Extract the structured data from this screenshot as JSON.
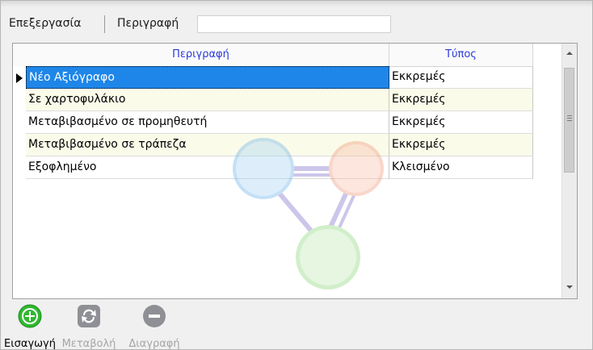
{
  "filter": {
    "mode_label": "Επεξεργασία",
    "field_label": "Περιγραφή",
    "value": ""
  },
  "grid": {
    "columns": [
      "Περιγραφή",
      "Τύπος"
    ],
    "rows": [
      {
        "description": "Νέο Αξιόγραφο",
        "type": "Εκκρεμές",
        "selected": true
      },
      {
        "description": "Σε χαρτοφυλάκιο",
        "type": "Εκκρεμές"
      },
      {
        "description": "Μεταβιβασμένο σε προμηθευτή",
        "type": "Εκκρεμές"
      },
      {
        "description": "Μεταβιβασμένο σε τράπεζα",
        "type": "Εκκρεμές"
      },
      {
        "description": "Εξοφλημένο",
        "type": "Κλεισμένο"
      }
    ]
  },
  "toolbar": {
    "insert_label": "Εισαγωγή",
    "modify_label": "Μεταβολή",
    "delete_label": "Διαγραφή"
  },
  "colors": {
    "selection": "#1e86e8",
    "header_text": "#2b3bd8",
    "alt_row": "#fbfbea",
    "insert_icon": "#2fb82f",
    "disabled_icon": "#8e9095"
  },
  "icons": {
    "insert": "plus-circle-icon",
    "modify": "refresh-arrows-icon",
    "delete": "minus-circle-icon"
  }
}
